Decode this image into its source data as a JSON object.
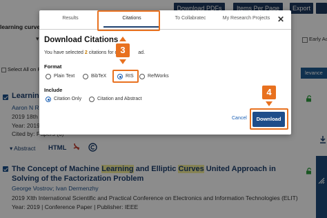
{
  "toolbar": {
    "download_pdfs": "Download PDFs",
    "items_per_page": "Items Per Page",
    "export": "Export"
  },
  "search_term": "learning curve",
  "select_all": "Select All on P",
  "early_access": "Early Acces",
  "relevance": "levance",
  "results": [
    {
      "title": "Learning",
      "authors": "Aaron N R",
      "conference": "2019 18th I",
      "year": "Year: 2019",
      "cited": "Cited by: Papers (6)",
      "abstract_label": "Abstract",
      "html_label": "HTML"
    },
    {
      "title_parts": [
        "The Concept of Machine ",
        "Learning",
        " and Elliptic ",
        "Curves",
        " United Approach in Solving of the Factorization Problem"
      ],
      "authors": "George Vostrov; Ivan Dermenzhy",
      "conference": "2019 XIth International Scientific and Practical Conference on Electronics and Information Technologies (ELIT)",
      "meta": "Year: 2019  |  Conference Paper  |  Publisher: IEEE"
    }
  ],
  "modal": {
    "tabs": [
      "Results",
      "Citations",
      "To Collabratec",
      "My Research Projects"
    ],
    "active_tab": "Citations",
    "close": "✕",
    "title": "Download Citations",
    "selection_pre": "You have selected ",
    "selection_count": "2",
    "selection_post": " citations for do",
    "selection_tail": "ad.",
    "format_label": "Format",
    "formats": [
      "Plain Text",
      "BibTeX",
      "RIS",
      "RefWorks"
    ],
    "selected_format": "RIS",
    "include_label": "Include",
    "include_options": [
      "Citation Only",
      "Citation and Abstract"
    ],
    "selected_include": "Citation Only",
    "cancel": "Cancel",
    "download": "Download"
  },
  "annotations": {
    "step3": "3",
    "step4": "4",
    "accent_color": "#e8711f"
  }
}
